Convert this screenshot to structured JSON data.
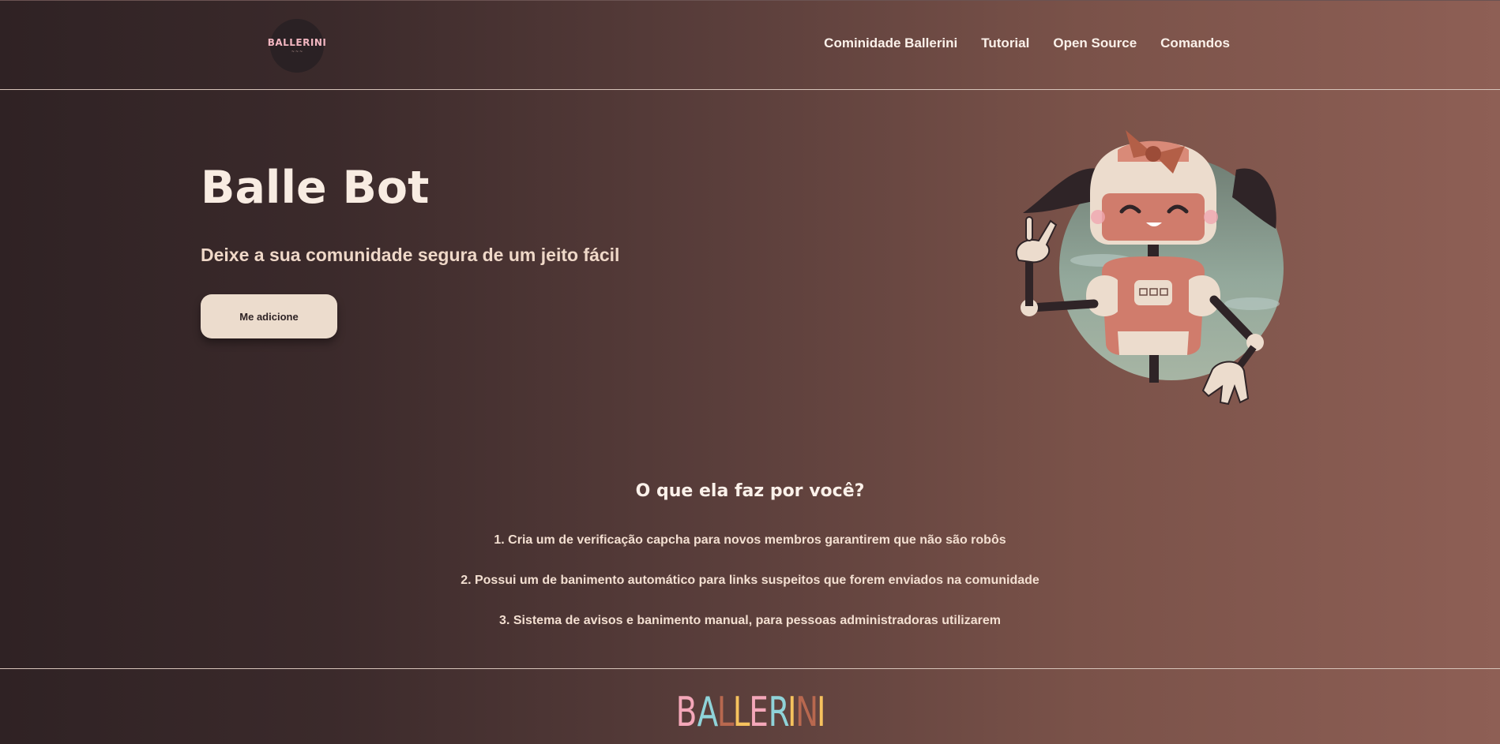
{
  "header": {
    "logo_text": "BALLERINI",
    "nav": [
      {
        "label": "Cominidade Ballerini"
      },
      {
        "label": "Tutorial"
      },
      {
        "label": "Open Source"
      },
      {
        "label": "Comandos"
      }
    ]
  },
  "hero": {
    "title": "Balle Bot",
    "subtitle": "Deixe a sua comunidade segura de um jeito fácil",
    "cta_label": "Me adicione"
  },
  "features": {
    "title": "O que ela faz por você?",
    "items": [
      "1. Cria um de verificação capcha para novos membros garantirem que não são robôs",
      "2. Possui um de banimento automático para links suspeitos que forem enviados na comunidade",
      "3. Sistema de avisos e banimento manual, para pessoas administradoras utilizarem"
    ]
  },
  "footer": {
    "logo_letters": [
      {
        "char": "B",
        "color": "#f4a7b9"
      },
      {
        "char": "A",
        "color": "#8fd3d9"
      },
      {
        "char": "L",
        "color": "#b8684f"
      },
      {
        "char": "L",
        "color": "#f6c25e"
      },
      {
        "char": "E",
        "color": "#f4a7b9"
      },
      {
        "char": "R",
        "color": "#8fd3d9"
      },
      {
        "char": "I",
        "color": "#f6c25e"
      },
      {
        "char": "N",
        "color": "#b8684f"
      },
      {
        "char": "I",
        "color": "#f6c25e"
      }
    ]
  },
  "icons": {
    "hero_illustration": "robot-girl-illustration",
    "header_logo": "ballerini-logo-icon"
  }
}
